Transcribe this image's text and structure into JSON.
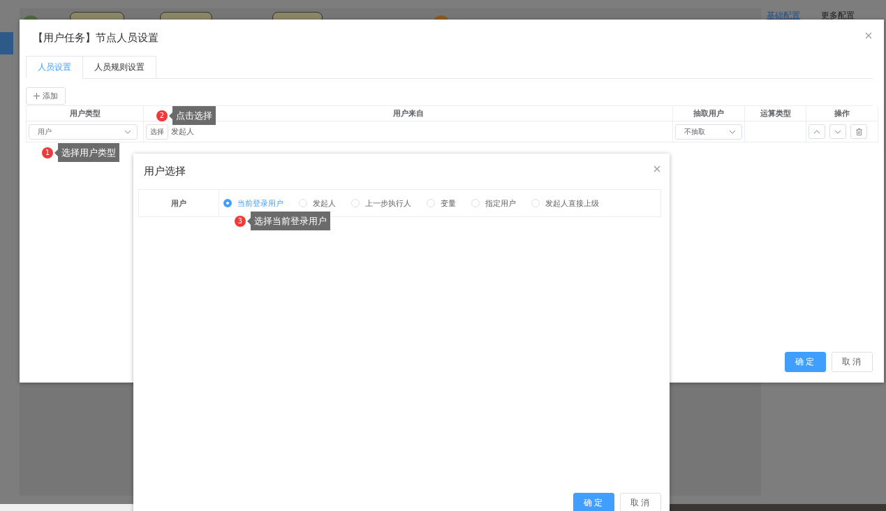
{
  "background": {
    "side_tabs": [
      {
        "label": "基础配置",
        "selected": true
      },
      {
        "label": "更多配置",
        "selected": false
      }
    ]
  },
  "dialog": {
    "title": "【用户任务】节点人员设置",
    "tabs": [
      {
        "label": "人员设置",
        "selected": true
      },
      {
        "label": "人员规则设置",
        "selected": false
      }
    ],
    "add_button": "添加",
    "table": {
      "columns": [
        "用户类型",
        "用户来自",
        "抽取用户",
        "运算类型",
        "操作"
      ],
      "rows": [
        {
          "user_type": "用户",
          "select_button": "选择",
          "source": "发起人",
          "extract": "不抽取"
        }
      ]
    },
    "buttons": [
      "确定",
      "取消"
    ]
  },
  "callouts": [
    {
      "number": "1",
      "text": "选择用户类型"
    },
    {
      "number": "2",
      "text": "点击选择"
    },
    {
      "number": "3",
      "text": "选择当前登录用户"
    }
  ],
  "user_dialog": {
    "title": "用户选择",
    "field_label": "用户",
    "options": [
      {
        "label": "当前登录用户",
        "selected": true
      },
      {
        "label": "发起人",
        "selected": false
      },
      {
        "label": "上一步执行人",
        "selected": false
      },
      {
        "label": "变量",
        "selected": false
      },
      {
        "label": "指定用户",
        "selected": false
      },
      {
        "label": "发起人直接上级",
        "selected": false
      }
    ],
    "buttons": [
      "确定",
      "取消"
    ]
  }
}
